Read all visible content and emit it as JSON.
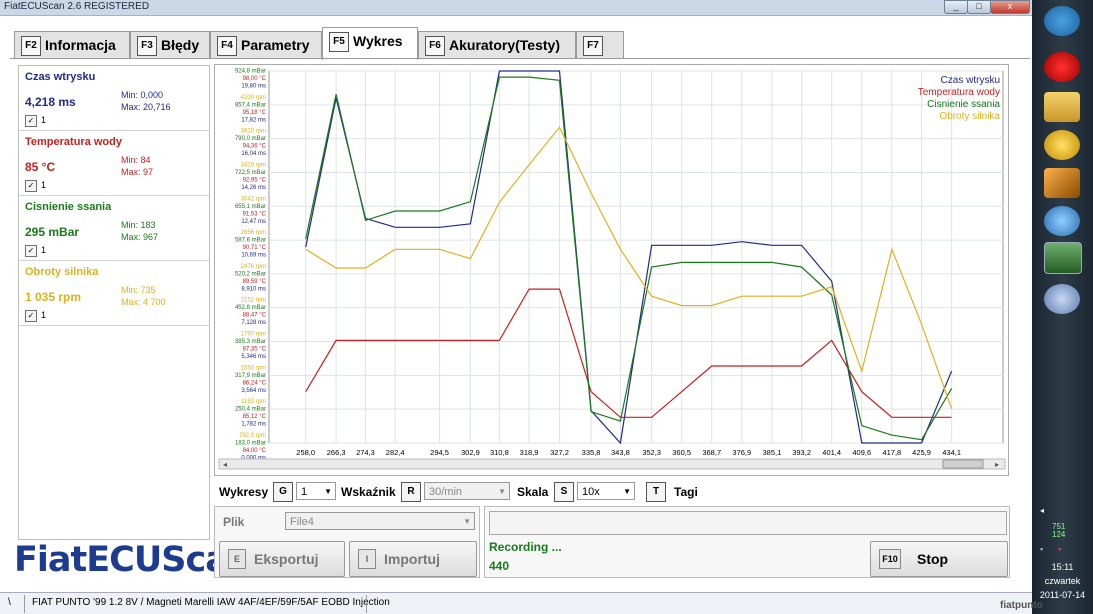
{
  "window": {
    "title": "FiatECUScan 2.6 REGISTERED",
    "btn_min": "_",
    "btn_max": "□",
    "btn_close": "x"
  },
  "tabs": [
    {
      "key": "F2",
      "label": "Informacja"
    },
    {
      "key": "F3",
      "label": "Błędy"
    },
    {
      "key": "F4",
      "label": "Parametry"
    },
    {
      "key": "F5",
      "label": "Wykres"
    },
    {
      "key": "F6",
      "label": "Akuratory(Testy)"
    },
    {
      "key": "F7",
      "label": ""
    }
  ],
  "sensors": [
    {
      "name": "Czas wtrysku",
      "value": "4,218 ms",
      "min": "Min: 0,000",
      "max": "Max: 20,716",
      "check": "✓",
      "index": "1",
      "color": "#1f2a8c"
    },
    {
      "name": "Temperatura wody",
      "value": "85 °C",
      "min": "Min: 84",
      "max": "Max: 97",
      "check": "✓",
      "index": "1",
      "color": "#c81e1e"
    },
    {
      "name": "Cisnienie ssania",
      "value": "295 mBar",
      "min": "Min: 183",
      "max": "Max: 967",
      "check": "✓",
      "index": "1",
      "color": "#1a7a1a"
    },
    {
      "name": "Obroty silnika",
      "value": "1 035 rpm",
      "min": "Min: 735",
      "max": "Max: 4 700",
      "check": "✓",
      "index": "1",
      "color": "#e0b020"
    }
  ],
  "logo": "FiatECUScan",
  "chart_data": {
    "type": "line",
    "x": [
      258.0,
      266.3,
      274.3,
      282.4,
      294.5,
      302.9,
      310.8,
      318.9,
      327.2,
      335.8,
      343.8,
      352.3,
      360.5,
      368.7,
      376.9,
      385.1,
      393.2,
      401.4,
      409.6,
      417.8,
      425.9,
      434.1
    ],
    "x_tick_labels": [
      "258,0",
      "266,3",
      "274,3",
      "282,4",
      "294,5",
      "302,9",
      "310,8",
      "318,9",
      "327,2",
      "335,8",
      "343,8",
      "352,3",
      "360,5",
      "368,7",
      "376,9",
      "385,1",
      "393,2",
      "401,4",
      "409,6",
      "417,8",
      "425,9",
      "434,1"
    ],
    "series": [
      {
        "name": "Czas wtrysku",
        "color": "#1f2a8c",
        "values": [
          10.9,
          19.2,
          12.5,
          12.0,
          12.0,
          12.2,
          20.7,
          20.7,
          20.7,
          1.8,
          0.0,
          11.0,
          11.0,
          11.0,
          11.2,
          11.0,
          11.0,
          9.0,
          0.0,
          0.0,
          0.0,
          4.0
        ]
      },
      {
        "name": "Temperatura wody",
        "color": "#c81e1e",
        "values": [
          86,
          88,
          88,
          88,
          88,
          88,
          88,
          90,
          90,
          86,
          85,
          85,
          86,
          87,
          87,
          87,
          87,
          88,
          86,
          85,
          85,
          85
        ]
      },
      {
        "name": "Cisnienie ssania",
        "color": "#1a7a1a",
        "values": [
          620,
          930,
          660,
          680,
          680,
          700,
          967,
          967,
          960,
          250,
          230,
          560,
          570,
          570,
          570,
          570,
          560,
          500,
          220,
          200,
          190,
          300
        ]
      },
      {
        "name": "Obroty silnika",
        "color": "#e0b020",
        "values": [
          2800,
          2600,
          2600,
          2800,
          2800,
          2700,
          3300,
          3700,
          4100,
          3400,
          2800,
          2300,
          2200,
          2200,
          2300,
          2300,
          2300,
          2400,
          1500,
          2800,
          2000,
          1100
        ]
      }
    ],
    "y_tick_labels": [
      [
        "4400 rpm",
        "924,8 mBar",
        "98,00 °C",
        "19,80 ms"
      ],
      [
        "4200 rpm",
        "857,4 mBar",
        "95,18 °C",
        "17,82 ms"
      ],
      [
        "3810 rpm",
        "790,0 mBar",
        "94,36 °C",
        "16,04 ms"
      ],
      [
        "3419 rpm",
        "722,5 mBar",
        "92,95 °C",
        "14,26 ms"
      ],
      [
        "3042 rpm",
        "655,1 mBar",
        "91,53 °C",
        "12,47 ms"
      ],
      [
        "2656 rpm",
        "587,6 mBar",
        "90,71 °C",
        "10,69 ms"
      ],
      [
        "2476 rpm",
        "520,2 mBar",
        "89,59 °C",
        "8,910 ms"
      ],
      [
        "2152 rpm",
        "452,8 mBar",
        "88,47 °C",
        "7,128 ms"
      ],
      [
        "1790 rpm",
        "385,3 mBar",
        "87,35 °C",
        "5,346 ms"
      ],
      [
        "1550 rpm",
        "317,9 mBar",
        "86,24 °C",
        "3,564 ms"
      ],
      [
        "1152 rpm",
        "250,4 mBar",
        "85,12 °C",
        "1,782 ms"
      ],
      [
        "792,0 rpm",
        "183,0 mBar",
        "84,00 °C",
        "0,000 ms"
      ]
    ],
    "legend_position": "top-right",
    "grid": true
  },
  "controls": {
    "wykresy_label": "Wykresy",
    "wykresy_key": "G",
    "wykresy_value": "1",
    "wskaznik_label": "Wskaźnik",
    "wskaznik_key": "R",
    "wskaznik_value": "30/min",
    "skala_label": "Skala",
    "skala_key": "S",
    "skala_value": "10x",
    "tagi_key": "T",
    "tagi_label": "Tagi"
  },
  "file": {
    "label": "Plik",
    "value": "File4",
    "export_key": "E",
    "export_label": "Eksportuj",
    "import_key": "I",
    "import_label": "Importuj"
  },
  "recording": {
    "status": "Recording ...",
    "count": "440",
    "stop_key": "F10",
    "stop_label": "Stop"
  },
  "statusbar": {
    "icon": "\\",
    "text": "FIAT PUNTO '99 1.2 8V / Magneti Marelli IAW 4AF/4EF/59F/5AF EOBD Injection"
  },
  "taskbar": {
    "time": "15:11",
    "day": "czwartek",
    "date": "2011-07-14",
    "net1": "751",
    "net2": "124"
  },
  "watermark": "fiatpunto"
}
